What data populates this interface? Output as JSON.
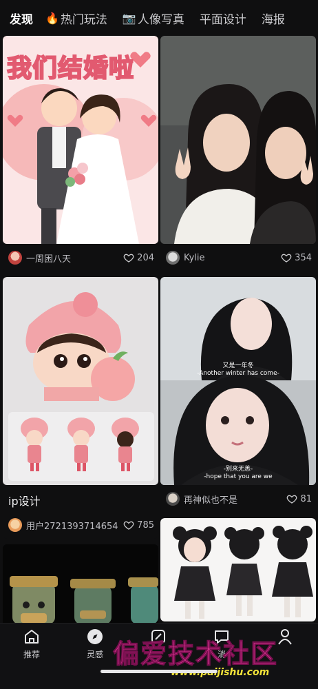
{
  "tabs": [
    {
      "label": "发现",
      "active": true,
      "emoji": ""
    },
    {
      "label": "热门玩法",
      "active": false,
      "emoji": "🔥"
    },
    {
      "label": "人像写真",
      "active": false,
      "emoji": "📷"
    },
    {
      "label": "平面设计",
      "active": false,
      "emoji": ""
    },
    {
      "label": "海报",
      "active": false,
      "emoji": ""
    }
  ],
  "cards": {
    "wedding": {
      "image_text": "我们结婚啦",
      "author": "一周困八天",
      "likes": "204"
    },
    "friends": {
      "author": "Kylie",
      "likes": "354"
    },
    "ip": {
      "title": "ip设计",
      "author": "用户2721393714654",
      "likes": "785"
    },
    "winter": {
      "caption1_cn": "又是一年冬",
      "caption1_en": "-Another winter has come-",
      "caption2_cn": "-别来无恙-",
      "caption2_en": "-hope that you are we",
      "author": "再神似也不是",
      "likes": "81"
    }
  },
  "nav": [
    {
      "label": "推荐",
      "icon": "home-icon"
    },
    {
      "label": "灵感",
      "icon": "compass-icon"
    },
    {
      "label": "",
      "icon": "create-icon"
    },
    {
      "label": "消",
      "icon": "message-icon"
    },
    {
      "label": "",
      "icon": "profile-icon"
    }
  ],
  "watermark": {
    "main": "偏爱技术社区",
    "url": "www.paijishu.com"
  },
  "colors": {
    "background": "#0f0f10",
    "watermark_pink": "#e53a98",
    "watermark_yellow": "#f2e33a"
  }
}
